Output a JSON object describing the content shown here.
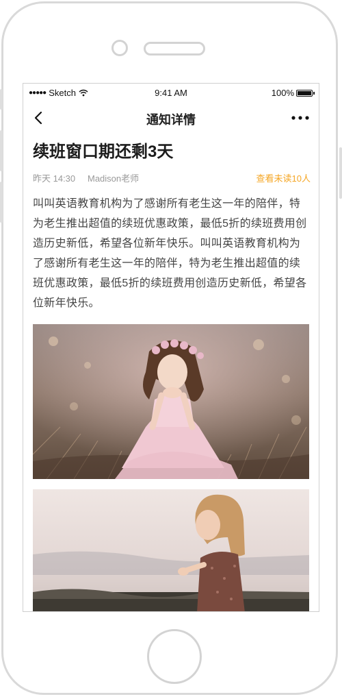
{
  "status_bar": {
    "signal_dots": "●●●●●",
    "carrier": "Sketch",
    "time": "9:41 AM",
    "battery_percent": "100%"
  },
  "nav": {
    "title": "通知详情",
    "back_icon": "chevron-left-icon",
    "more_icon": "more-horizontal-icon"
  },
  "notice": {
    "title": "续班窗口期还剩3天",
    "time": "昨天 14:30",
    "author": "Madison老师",
    "unread_link": "查看未读10人",
    "body": "叫叫英语教育机构为了感谢所有老生这一年的陪伴，特为老生推出超值的续班优惠政策，最低5折的续班费用创造历史新低，希望各位新年快乐。叫叫英语教育机构为了感谢所有老生这一年的陪伴，特为老生推出超值的续班优惠政策，最低5折的续班费用创造历史新低，希望各位新年快乐。"
  },
  "colors": {
    "accent": "#f5a623",
    "meta_text": "#999999",
    "title_text": "#1c1c1c"
  }
}
